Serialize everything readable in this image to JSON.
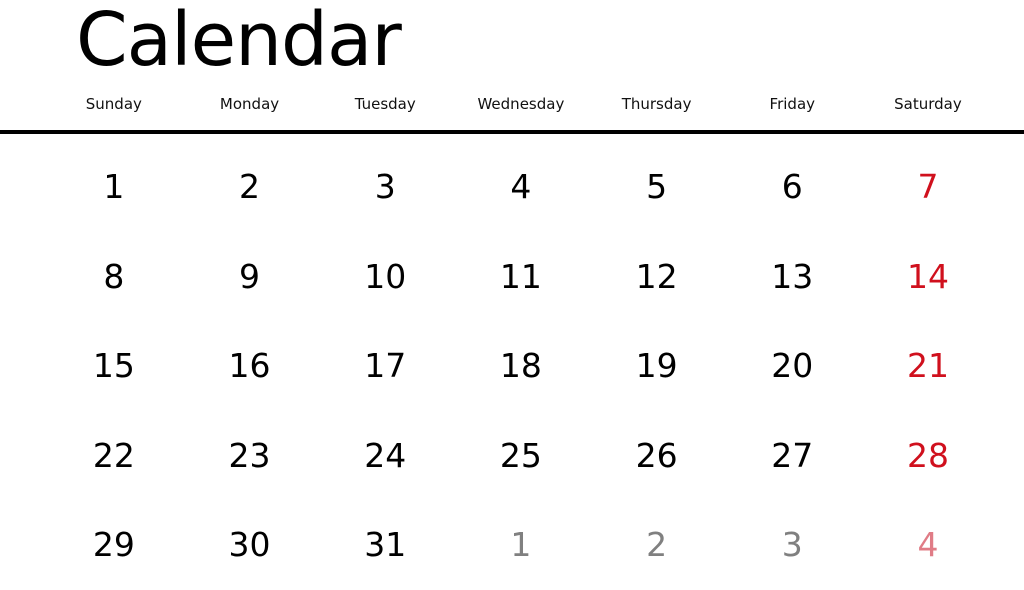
{
  "title": "Calendar",
  "colors": {
    "text": "#000000",
    "saturday": "#d0101d",
    "other_month": "#808080",
    "other_month_saturday": "#e07c86"
  },
  "weekdays": [
    "Sunday",
    "Monday",
    "Tuesday",
    "Wednesday",
    "Thursday",
    "Friday",
    "Saturday"
  ],
  "weeks": [
    [
      {
        "day": "1"
      },
      {
        "day": "2"
      },
      {
        "day": "3"
      },
      {
        "day": "4"
      },
      {
        "day": "5"
      },
      {
        "day": "6"
      },
      {
        "day": "7"
      }
    ],
    [
      {
        "day": "8"
      },
      {
        "day": "9"
      },
      {
        "day": "10"
      },
      {
        "day": "11"
      },
      {
        "day": "12"
      },
      {
        "day": "13"
      },
      {
        "day": "14"
      }
    ],
    [
      {
        "day": "15"
      },
      {
        "day": "16"
      },
      {
        "day": "17"
      },
      {
        "day": "18"
      },
      {
        "day": "19"
      },
      {
        "day": "20"
      },
      {
        "day": "21"
      }
    ],
    [
      {
        "day": "22"
      },
      {
        "day": "23"
      },
      {
        "day": "24"
      },
      {
        "day": "25"
      },
      {
        "day": "26"
      },
      {
        "day": "27"
      },
      {
        "day": "28"
      }
    ],
    [
      {
        "day": "29"
      },
      {
        "day": "30"
      },
      {
        "day": "31"
      },
      {
        "day": "1",
        "other_month": true
      },
      {
        "day": "2",
        "other_month": true
      },
      {
        "day": "3",
        "other_month": true
      },
      {
        "day": "4",
        "other_month": true
      }
    ]
  ]
}
